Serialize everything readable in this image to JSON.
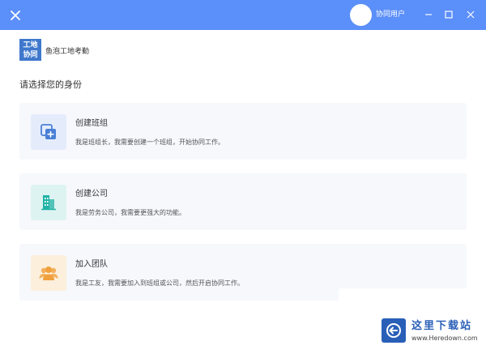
{
  "titlebar": {
    "username": "协同用户",
    "accent": "#5b8ff9"
  },
  "brand": {
    "logo_line1": "工地",
    "logo_line2": "协同",
    "app_name": "鱼泡工地考勤"
  },
  "main": {
    "prompt": "请选择您的身份",
    "options": [
      {
        "title": "创建班组",
        "desc": "我是班组长，我需要创建一个班组，开始协同工作。",
        "icon": "add-copy-icon",
        "icon_color": "#4a7fd6",
        "icon_bg": "#e4ecfb"
      },
      {
        "title": "创建公司",
        "desc": "我是劳务公司，我需要更强大的功能。",
        "icon": "building-icon",
        "icon_color": "#22b3a6",
        "icon_bg": "#ddf3f1"
      },
      {
        "title": "加入团队",
        "desc": "我是工友，我需要加入到班组或公司，然后开启协同工作。",
        "icon": "team-icon",
        "icon_color": "#f0a03c",
        "icon_bg": "#fcefdc"
      }
    ]
  },
  "watermark": {
    "title": "这里下载站",
    "url": "www.Heredown.com",
    "color": "#2a5fb8"
  }
}
